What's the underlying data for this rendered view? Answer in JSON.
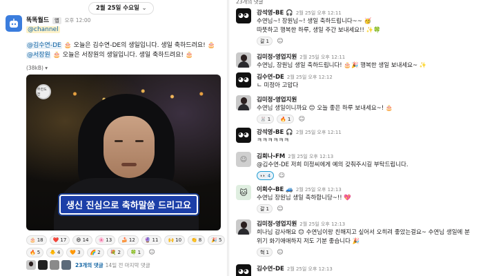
{
  "date_pill": {
    "label": "2월 25일 수요일"
  },
  "message": {
    "author": "똑똑월드",
    "app_badge": "앱",
    "time": "오후 12:00",
    "channel_mention": "@channel",
    "line1_mention": "@김수연-DE",
    "line1_text": "🎂 오늘은 김수연-DE의 생일입니다. 생일 축하드려요! 🎂",
    "line2_mention": "@서장원",
    "line2_text": "🎂 오늘은 서장원의 생일입니다. 생일 축하드려요! 🎂",
    "filesize": "(38kB) ▾",
    "video_caption": "생신 진심으로 축하말씀 드리고요",
    "video_logo": "무한도전"
  },
  "reactions_row1": [
    {
      "icon": "🎂",
      "count": "18"
    },
    {
      "icon": "❤️",
      "count": "17"
    },
    {
      "icon": "😄",
      "count": "14"
    },
    {
      "icon": "🌸",
      "count": "13"
    },
    {
      "icon": "🍰",
      "count": "12"
    },
    {
      "icon": "🔮",
      "count": "11"
    },
    {
      "icon": "🙌",
      "count": "10"
    },
    {
      "icon": "👏",
      "count": "8"
    },
    {
      "icon": "🎉",
      "count": "5"
    }
  ],
  "reactions_row2": [
    {
      "icon": "🔥",
      "count": "5"
    },
    {
      "icon": "🐥",
      "count": "4"
    },
    {
      "icon": "🧡",
      "count": "3"
    },
    {
      "icon": "🌈",
      "count": "2"
    },
    {
      "icon": "💐",
      "count": "2"
    },
    {
      "icon": "🍀",
      "count": "1"
    }
  ],
  "thread_summary": {
    "replies": "23개의 댓글",
    "last_reply": "14일 전 마지막 댓글"
  },
  "thread": {
    "reply_count": "23개의 댓글",
    "messages": [
      {
        "name": "강석영-BE 🎧",
        "time": "2월 25일 오후 12:11",
        "lines": [
          "수연님~! 장원님~! 생일 축하드립니다~~ 🥳",
          "따뜻하고 행복한 하루, 생일 주간 보내세요!! ✨🍀"
        ],
        "reactions": [
          {
            "icon": "갈",
            "count": "1"
          }
        ]
      },
      {
        "name": "김미정-영업지원",
        "time": "2월 25일 오후 12:11",
        "lines": [
          "수연님, 장원님 생일 축하드립니다! 🎂🎉 행복한 생일 보내세요~ ✨"
        ],
        "reactions": []
      },
      {
        "name": "김수연-DE",
        "time": "2월 25일 오후 12:12",
        "lines": [
          "ㄴ 미정아 고맙다"
        ],
        "reactions": []
      },
      {
        "name": "김미정-영업지원",
        "time": "",
        "lines": [
          "수연님 생일이니까요 😊 오늘 좋은 하루 보내세요~! 🎂"
        ],
        "reactions": [
          {
            "icon": "🐰",
            "count": "1"
          },
          {
            "icon": "🔥",
            "count": "1"
          }
        ]
      },
      {
        "name": "강석영-BE 🎧",
        "time": "2월 25일 오후 12:11",
        "lines": [
          "ㅋㅋㅋㅋㅋㅋ"
        ],
        "reactions": []
      },
      {
        "name": "김희나-FM",
        "time": "2월 25일 오후 12:13",
        "lines": [
          "@김수연-DE 저희 미정씨에게 예의 갖춰주시길 부탁드립니다."
        ],
        "reactions": [
          {
            "icon": "👀",
            "count": "4"
          }
        ]
      },
      {
        "name": "이희수-BE 🚙",
        "time": "2월 25일 오후 12:13",
        "lines": [
          "수연님 장원님 생일 축하합니당~!! 💖"
        ],
        "reactions": [
          {
            "icon": "갈",
            "count": "1"
          }
        ]
      },
      {
        "name": "김미정-영업지원",
        "time": "2월 25일 오후 12:13",
        "lines": [
          "희나님 감사해요 😊 수연님이랑 친해지고 싶어서 오히려 좋았는걸요~ 수연님 생일에 분",
          "위기 화기애애하지 저도 기분 좋습니다 🎉"
        ],
        "reactions": [
          {
            "icon": "혁",
            "count": "1"
          }
        ]
      },
      {
        "name": "김수연-DE",
        "time": "2월 25일 오후 12:13",
        "lines": [
          ""
        ],
        "reactions": []
      }
    ]
  }
}
